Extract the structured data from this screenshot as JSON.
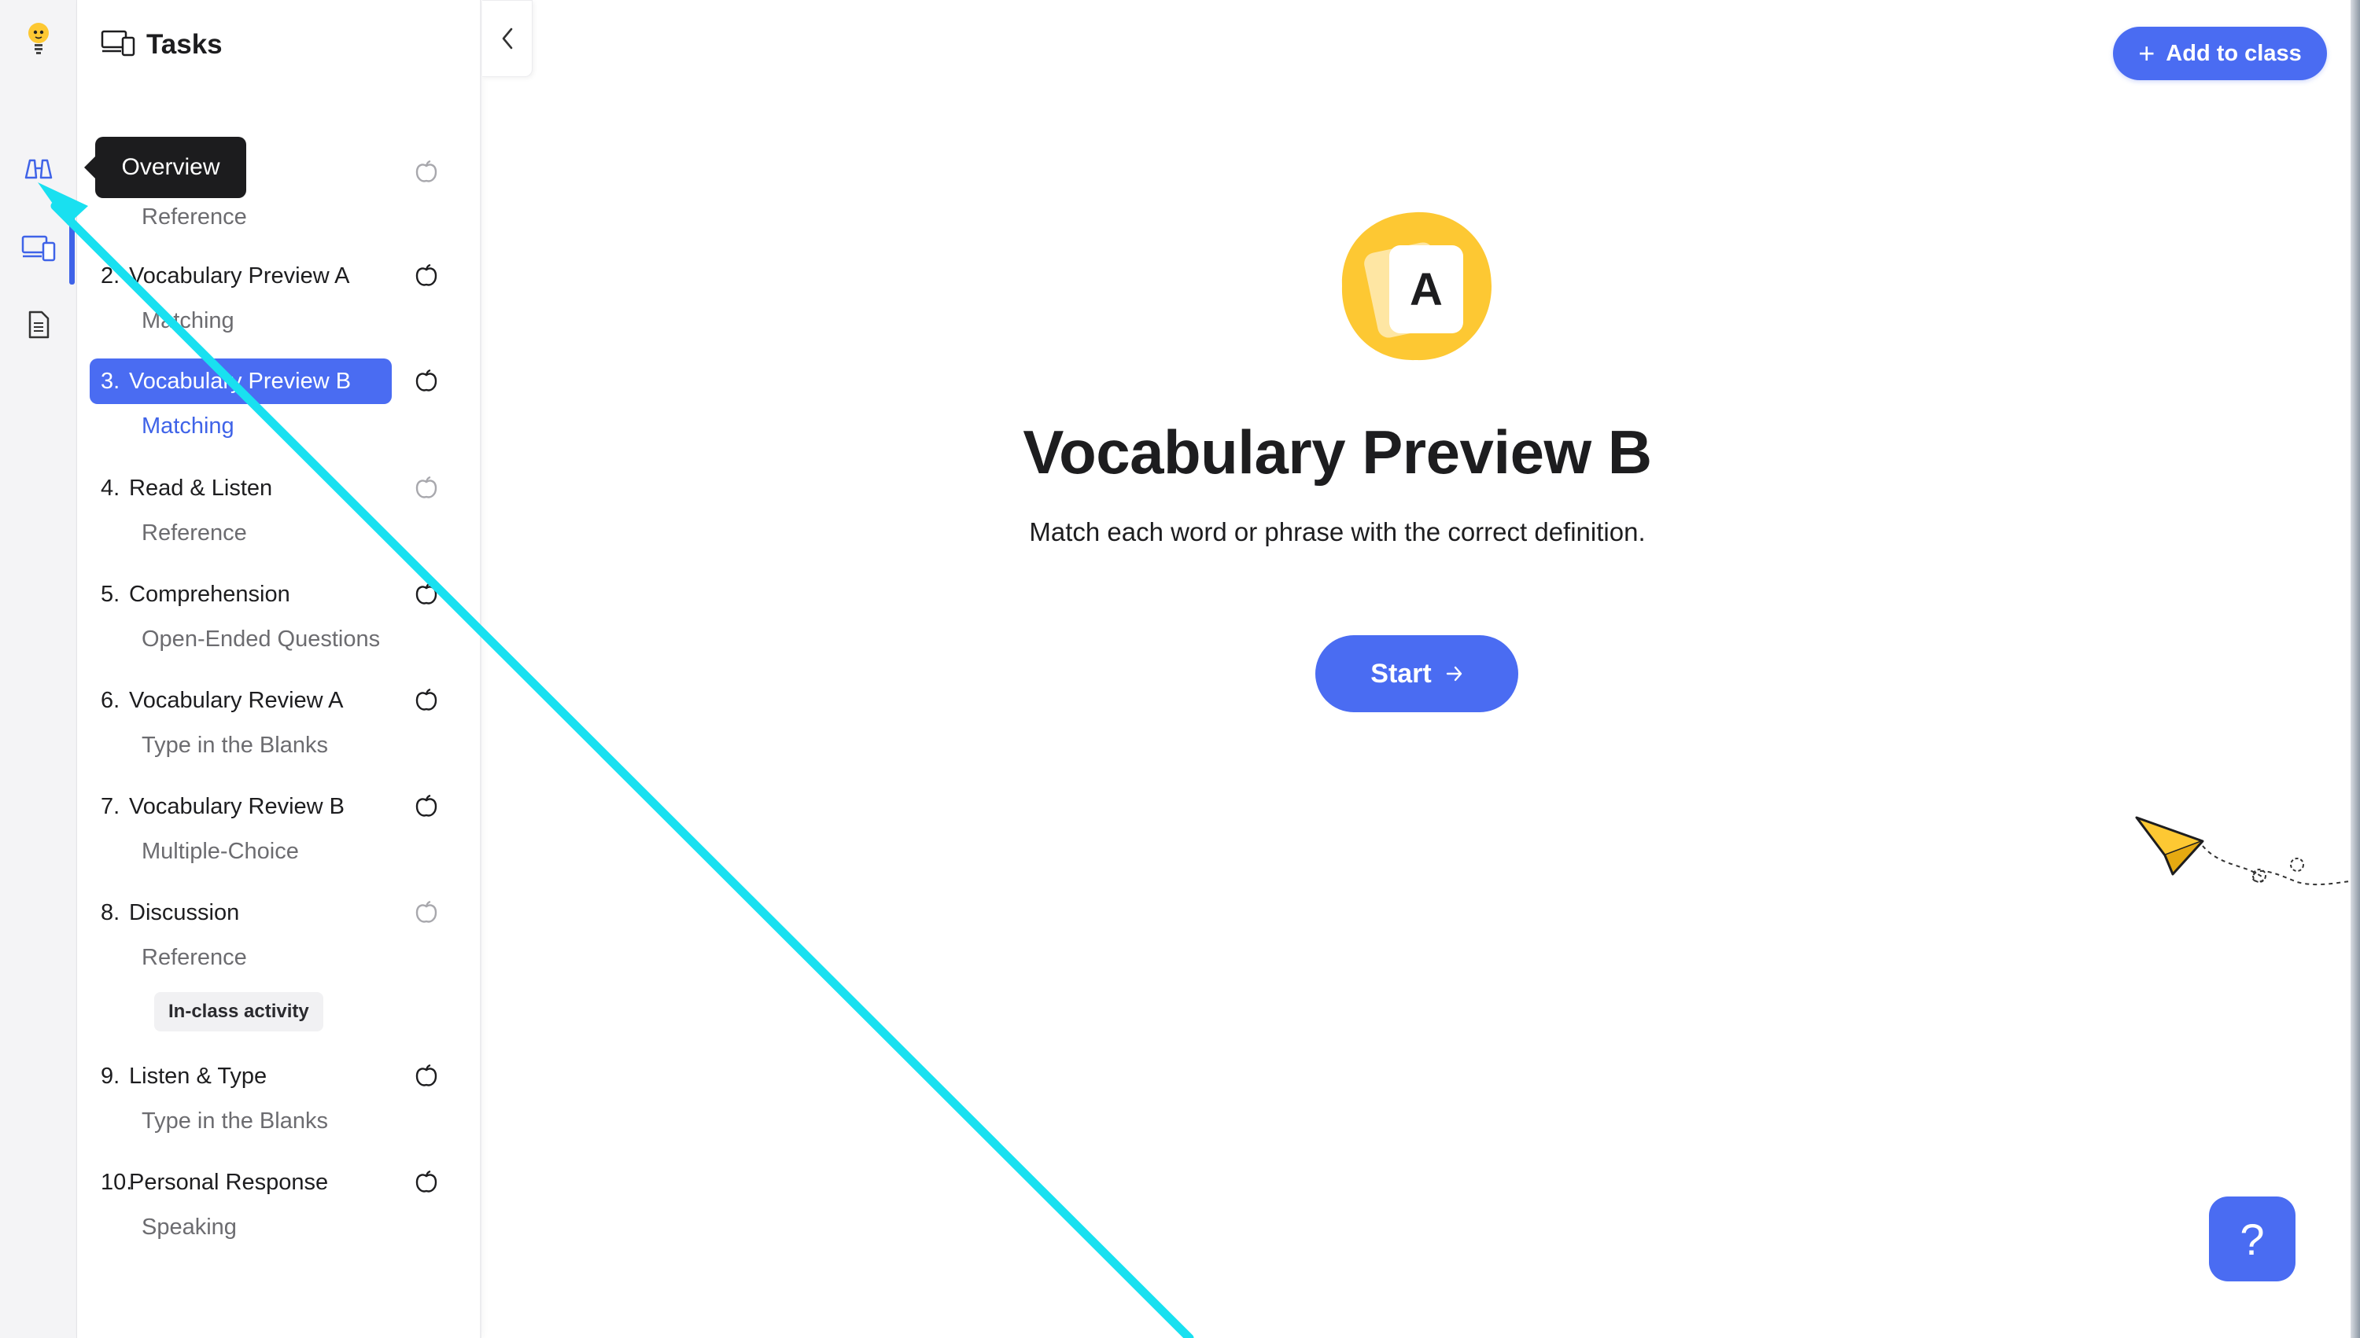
{
  "sidebar": {
    "title": "Tasks",
    "collapse_icon": "chevron-left-icon",
    "items": [
      {
        "num": "",
        "title": "",
        "subtitle": "Reference",
        "icon": "apple-icon"
      },
      {
        "num": "2.",
        "title": "Vocabulary Preview A",
        "subtitle": "Matching",
        "icon": "apple-icon"
      },
      {
        "num": "3.",
        "title": "Vocabulary Preview B",
        "subtitle": "Matching",
        "icon": "apple-icon",
        "active": true
      },
      {
        "num": "4.",
        "title": "Read & Listen",
        "subtitle": "Reference",
        "icon": "apple-icon"
      },
      {
        "num": "5.",
        "title": "Comprehension",
        "subtitle": "Open-Ended Questions",
        "icon": "apple-icon"
      },
      {
        "num": "6.",
        "title": "Vocabulary Review A",
        "subtitle": "Type in the Blanks",
        "icon": "apple-icon"
      },
      {
        "num": "7.",
        "title": "Vocabulary Review B",
        "subtitle": "Multiple-Choice",
        "icon": "apple-icon"
      },
      {
        "num": "8.",
        "title": "Discussion",
        "subtitle": "Reference",
        "badge": "In-class activity",
        "icon": "apple-icon"
      },
      {
        "num": "9.",
        "title": "Listen & Type",
        "subtitle": "Type in the Blanks",
        "icon": "apple-icon"
      },
      {
        "num": "10.",
        "title": "Personal Response",
        "subtitle": "Speaking",
        "icon": "apple-icon"
      }
    ]
  },
  "rail": {
    "icons": [
      "lightbulb-icon",
      "binoculars-icon",
      "devices-icon",
      "document-icon"
    ]
  },
  "tooltip": {
    "text": "Overview"
  },
  "header": {
    "add_to_class_label": "Add to class"
  },
  "main": {
    "logo_letter": "A",
    "activity_title": "Vocabulary Preview B",
    "activity_description": "Match each word or phrase with the correct definition.",
    "start_label": "Start"
  },
  "help": {
    "label": "?"
  },
  "colors": {
    "accent": "#4a6cf2",
    "logo_yellow": "#fdc833",
    "annotation_cyan": "#19e0f0"
  }
}
